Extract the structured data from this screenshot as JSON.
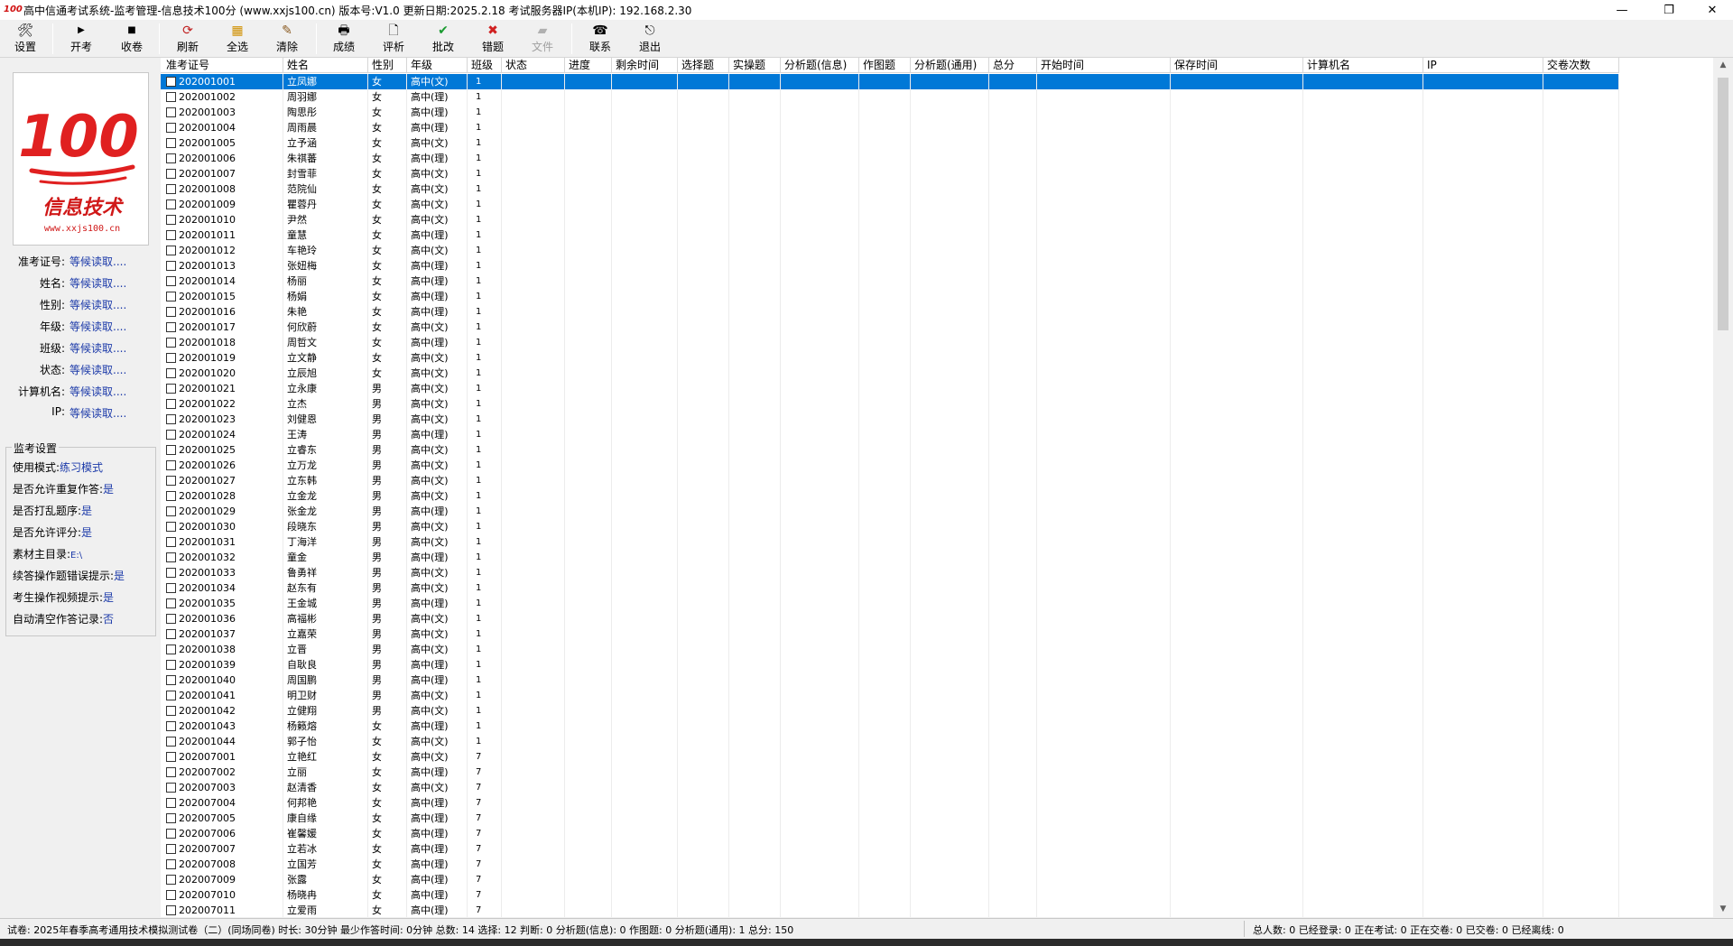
{
  "window": {
    "title": "高中信通考试系统-监考管理-信息技术100分 (www.xxjs100.cn)  版本号:V1.0 更新日期:2025.2.18   考试服务器IP(本机IP):  192.168.2.30",
    "minimize": "—",
    "restore": "❐",
    "close": "✕"
  },
  "toolbar": {
    "settings": "设置",
    "start": "开考",
    "collect": "收卷",
    "refresh": "刷新",
    "select_all": "全选",
    "clear": "清除",
    "scores": "成绩",
    "analysis": "评析",
    "grade": "批改",
    "wrong": "错题",
    "files": "文件",
    "contact": "联系",
    "exit": "退出"
  },
  "logo": {
    "number": "100",
    "brand": "信息技术",
    "url": "www.xxjs100.cn"
  },
  "info": [
    {
      "label": "准考证号:",
      "value": "等候读取...."
    },
    {
      "label": "姓名:",
      "value": "等候读取...."
    },
    {
      "label": "性别:",
      "value": "等候读取...."
    },
    {
      "label": "年级:",
      "value": "等候读取...."
    },
    {
      "label": "班级:",
      "value": "等候读取...."
    },
    {
      "label": "状态:",
      "value": "等候读取...."
    },
    {
      "label": "计算机名:",
      "value": "等候读取...."
    },
    {
      "label": "IP:",
      "value": "等候读取...."
    }
  ],
  "monitor": {
    "legend": "监考设置",
    "rows": [
      {
        "label": "使用模式:",
        "value": "练习模式"
      },
      {
        "label": "是否允许重复作答:",
        "value": "是"
      },
      {
        "label": "是否打乱题序:",
        "value": "是"
      },
      {
        "label": "是否允许评分:",
        "value": "是"
      },
      {
        "label": "素材主目录:",
        "value": "E:\\"
      },
      {
        "label": "续答操作题错误提示:",
        "value": "是"
      },
      {
        "label": "考生操作视频提示:",
        "value": "是"
      },
      {
        "label": "自动清空作答记录:",
        "value": "否"
      }
    ]
  },
  "columns": [
    "准考证号",
    "姓名",
    "性别",
    "年级",
    "班级",
    "状态",
    "进度",
    "剩余时间",
    "选择题",
    "实操题",
    "分析题(信息)",
    "作图题",
    "分析题(通用)",
    "总分",
    "开始时间",
    "保存时间",
    "计算机名",
    "IP",
    "交卷次数"
  ],
  "rows": [
    [
      "202001001",
      "立凤娜",
      "女",
      "高中(文)",
      "1"
    ],
    [
      "202001002",
      "周羽娜",
      "女",
      "高中(理)",
      "1"
    ],
    [
      "202001003",
      "陶思彤",
      "女",
      "高中(理)",
      "1"
    ],
    [
      "202001004",
      "周雨晨",
      "女",
      "高中(理)",
      "1"
    ],
    [
      "202001005",
      "立予涵",
      "女",
      "高中(文)",
      "1"
    ],
    [
      "202001006",
      "朱祺蕃",
      "女",
      "高中(理)",
      "1"
    ],
    [
      "202001007",
      "封雪菲",
      "女",
      "高中(文)",
      "1"
    ],
    [
      "202001008",
      "范院仙",
      "女",
      "高中(文)",
      "1"
    ],
    [
      "202001009",
      "瞿蓉丹",
      "女",
      "高中(文)",
      "1"
    ],
    [
      "202001010",
      "尹然",
      "女",
      "高中(文)",
      "1"
    ],
    [
      "202001011",
      "童慧",
      "女",
      "高中(理)",
      "1"
    ],
    [
      "202001012",
      "车艳玲",
      "女",
      "高中(文)",
      "1"
    ],
    [
      "202001013",
      "张妞梅",
      "女",
      "高中(理)",
      "1"
    ],
    [
      "202001014",
      "杨丽",
      "女",
      "高中(理)",
      "1"
    ],
    [
      "202001015",
      "杨娟",
      "女",
      "高中(理)",
      "1"
    ],
    [
      "202001016",
      "朱艳",
      "女",
      "高中(理)",
      "1"
    ],
    [
      "202001017",
      "何欣蔚",
      "女",
      "高中(文)",
      "1"
    ],
    [
      "202001018",
      "周哲文",
      "女",
      "高中(理)",
      "1"
    ],
    [
      "202001019",
      "立文静",
      "女",
      "高中(文)",
      "1"
    ],
    [
      "202001020",
      "立辰旭",
      "女",
      "高中(文)",
      "1"
    ],
    [
      "202001021",
      "立永康",
      "男",
      "高中(文)",
      "1"
    ],
    [
      "202001022",
      "立杰",
      "男",
      "高中(文)",
      "1"
    ],
    [
      "202001023",
      "刘健恩",
      "男",
      "高中(文)",
      "1"
    ],
    [
      "202001024",
      "王涛",
      "男",
      "高中(理)",
      "1"
    ],
    [
      "202001025",
      "立睿东",
      "男",
      "高中(文)",
      "1"
    ],
    [
      "202001026",
      "立万龙",
      "男",
      "高中(文)",
      "1"
    ],
    [
      "202001027",
      "立东韩",
      "男",
      "高中(文)",
      "1"
    ],
    [
      "202001028",
      "立金龙",
      "男",
      "高中(文)",
      "1"
    ],
    [
      "202001029",
      "张金龙",
      "男",
      "高中(理)",
      "1"
    ],
    [
      "202001030",
      "段晓东",
      "男",
      "高中(文)",
      "1"
    ],
    [
      "202001031",
      "丁海洋",
      "男",
      "高中(文)",
      "1"
    ],
    [
      "202001032",
      "童金",
      "男",
      "高中(理)",
      "1"
    ],
    [
      "202001033",
      "鲁勇祥",
      "男",
      "高中(文)",
      "1"
    ],
    [
      "202001034",
      "赵东有",
      "男",
      "高中(文)",
      "1"
    ],
    [
      "202001035",
      "王金城",
      "男",
      "高中(理)",
      "1"
    ],
    [
      "202001036",
      "高福彬",
      "男",
      "高中(文)",
      "1"
    ],
    [
      "202001037",
      "立嘉荣",
      "男",
      "高中(文)",
      "1"
    ],
    [
      "202001038",
      "立晋",
      "男",
      "高中(文)",
      "1"
    ],
    [
      "202001039",
      "自耿良",
      "男",
      "高中(理)",
      "1"
    ],
    [
      "202001040",
      "周国鹏",
      "男",
      "高中(理)",
      "1"
    ],
    [
      "202001041",
      "明卫财",
      "男",
      "高中(文)",
      "1"
    ],
    [
      "202001042",
      "立健翔",
      "男",
      "高中(文)",
      "1"
    ],
    [
      "202001043",
      "杨籁熔",
      "女",
      "高中(理)",
      "1"
    ],
    [
      "202001044",
      "郭子怡",
      "女",
      "高中(文)",
      "1"
    ],
    [
      "202007001",
      "立艳红",
      "女",
      "高中(文)",
      "7"
    ],
    [
      "202007002",
      "立丽",
      "女",
      "高中(理)",
      "7"
    ],
    [
      "202007003",
      "赵清香",
      "女",
      "高中(文)",
      "7"
    ],
    [
      "202007004",
      "何邦艳",
      "女",
      "高中(理)",
      "7"
    ],
    [
      "202007005",
      "康自缘",
      "女",
      "高中(理)",
      "7"
    ],
    [
      "202007006",
      "崔馨媛",
      "女",
      "高中(理)",
      "7"
    ],
    [
      "202007007",
      "立若冰",
      "女",
      "高中(理)",
      "7"
    ],
    [
      "202007008",
      "立国芳",
      "女",
      "高中(理)",
      "7"
    ],
    [
      "202007009",
      "张露",
      "女",
      "高中(理)",
      "7"
    ],
    [
      "202007010",
      "杨晓冉",
      "女",
      "高中(理)",
      "7"
    ],
    [
      "202007011",
      "立爱雨",
      "女",
      "高中(理)",
      "7"
    ]
  ],
  "status": {
    "left": "试卷: 2025年春季高考通用技术模拟测试卷（二）(同场同卷) 时长: 30分钟 最少作答时间: 0分钟  总数: 14 选择: 12 判断: 0 分析题(信息): 0 作图题: 0 分析题(通用): 1 总分: 150",
    "right": "总人数: 0 已经登录: 0 正在考试: 0 正在交卷: 0 已交卷: 0 已经离线: 0"
  }
}
